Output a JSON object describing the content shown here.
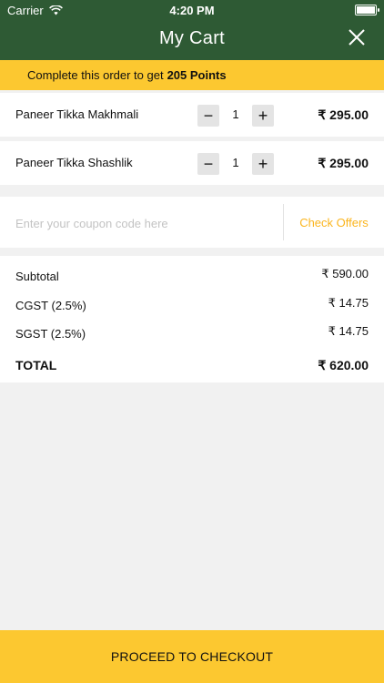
{
  "status_bar": {
    "carrier": "Carrier",
    "time": "4:20 PM"
  },
  "header": {
    "title": "My Cart"
  },
  "banner": {
    "text": "Complete this order to get",
    "points": "205 Points"
  },
  "items": [
    {
      "name": "Paneer Tikka Makhmali",
      "minus": "−",
      "qty": "1",
      "plus": "+",
      "price": "₹ 295.00"
    },
    {
      "name": "Paneer Tikka Shashlik",
      "minus": "−",
      "qty": "1",
      "plus": "+",
      "price": "₹ 295.00"
    }
  ],
  "coupon": {
    "placeholder": "Enter your coupon code here",
    "check_offers_label": "Check Offers"
  },
  "summary": {
    "subtotal_label": "Subtotal",
    "subtotal_value": "₹ 590.00",
    "cgst_label": "CGST (2.5%)",
    "cgst_value": "₹ 14.75",
    "sgst_label": "SGST (2.5%)",
    "sgst_value": "₹ 14.75",
    "total_label": "TOTAL",
    "total_value": "₹ 620.00"
  },
  "footer": {
    "checkout_label": "PROCEED TO CHECKOUT"
  },
  "colors": {
    "header_green": "#2e5a34",
    "accent_yellow": "#fcc830",
    "offers_text": "#fbb51e"
  },
  "icons": {
    "wifi": "wifi-icon",
    "battery": "battery-icon",
    "close": "close-icon"
  }
}
